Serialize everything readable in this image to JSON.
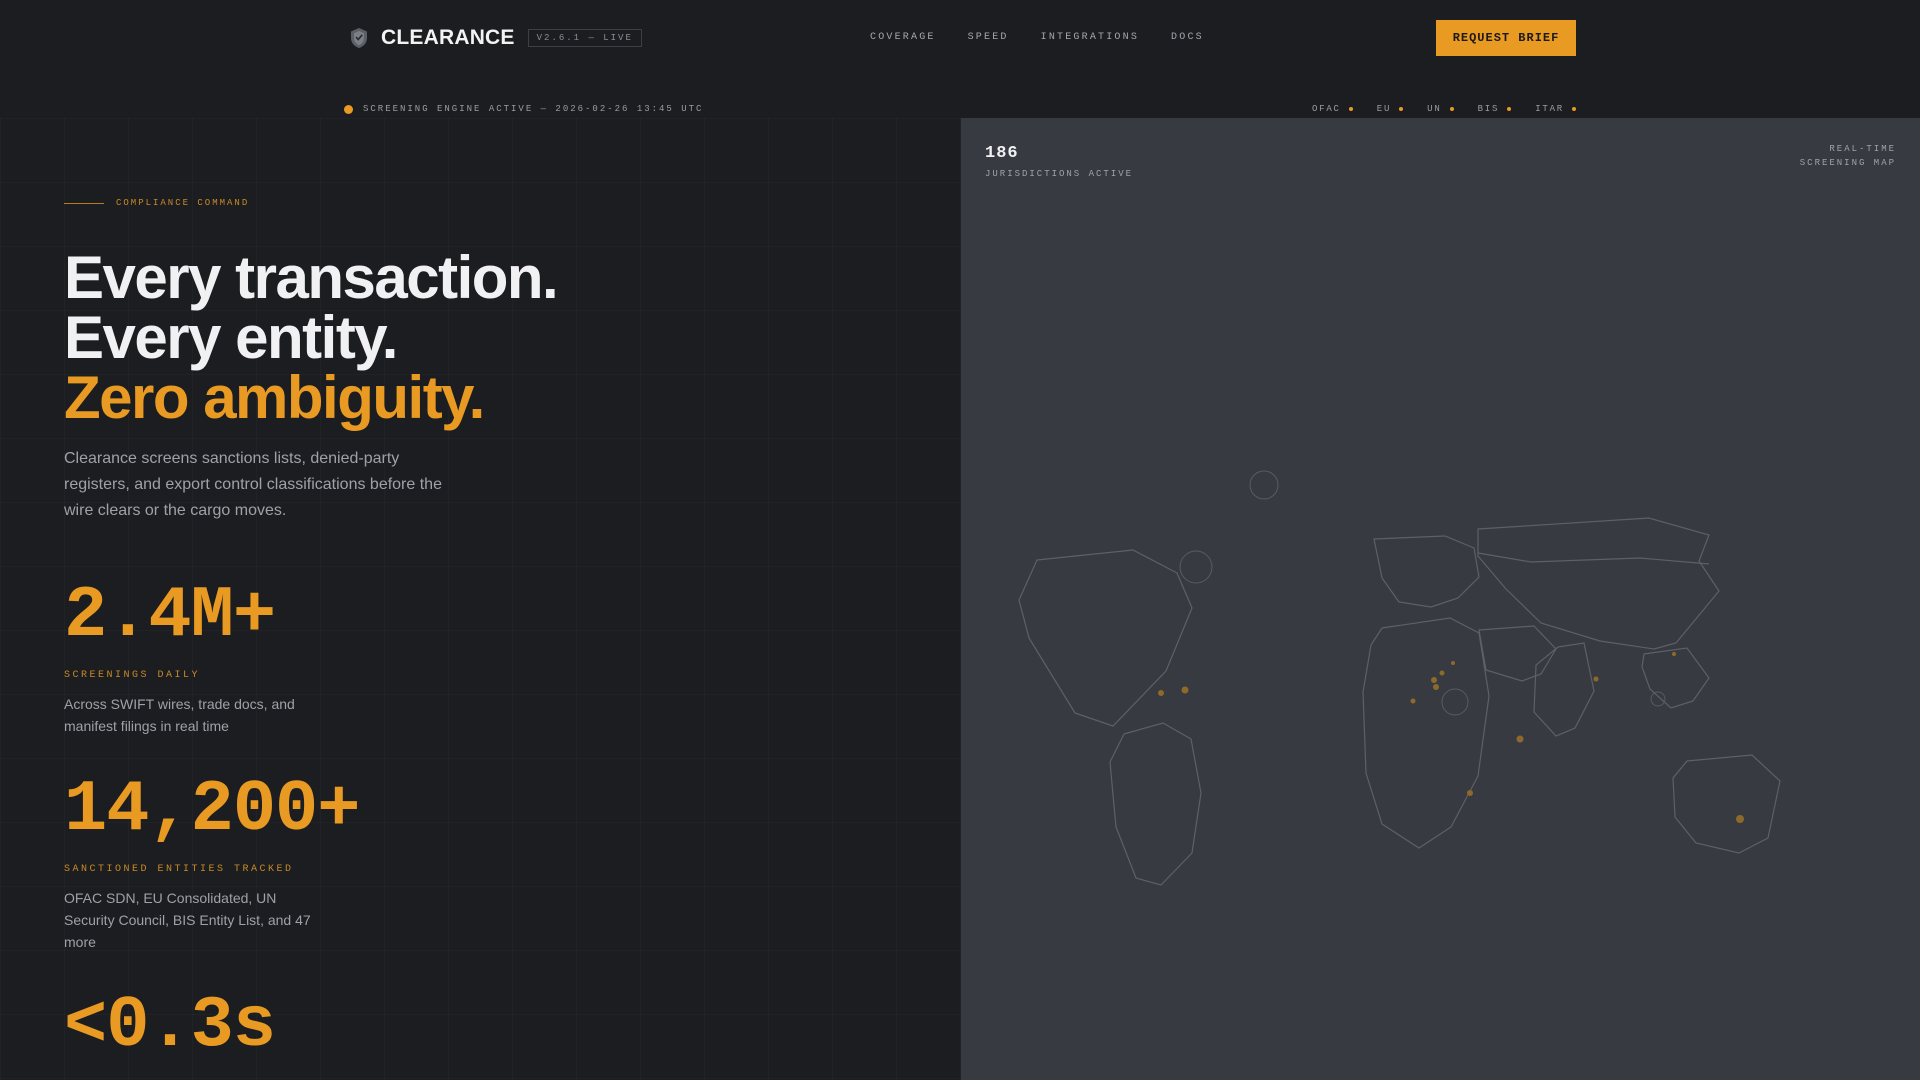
{
  "brand": {
    "name": "CLEARANCE",
    "version": "V2.6.1 — LIVE"
  },
  "nav": {
    "items": [
      "COVERAGE",
      "SPEED",
      "INTEGRATIONS",
      "DOCS"
    ],
    "cta": "REQUEST BRIEF"
  },
  "status": {
    "text": "SCREENING ENGINE ACTIVE — 2026-02-26 13:45 UTC",
    "regimes": [
      "OFAC",
      "EU",
      "UN",
      "BIS",
      "ITAR"
    ]
  },
  "hero": {
    "eyebrow": "COMPLIANCE COMMAND",
    "headline_line1": "Every transaction.",
    "headline_line2": "Every entity.",
    "headline_line3": "Zero ambiguity.",
    "lede": "Clearance screens sanctions lists, denied-party registers, and export control classifications before the wire clears or the cargo moves."
  },
  "stats": [
    {
      "value": "2.4M+",
      "label": "SCREENINGS DAILY",
      "desc": "Across SWIFT wires, trade docs, and manifest filings in real time"
    },
    {
      "value": "14,200+",
      "label": "SANCTIONED ENTITIES TRACKED",
      "desc": "OFAC SDN, EU Consolidated, UN Security Council, BIS Entity List, and 47 more"
    },
    {
      "value": "<0.3s",
      "label": "",
      "desc": ""
    }
  ],
  "map": {
    "count": "186",
    "count_label": "JURISDICTIONS ACTIVE",
    "title_line1": "REAL-TIME",
    "title_line2": "SCREENING MAP"
  },
  "colors": {
    "accent": "#e89a22",
    "background": "#1c1d21",
    "map_panel": "#383a41"
  }
}
